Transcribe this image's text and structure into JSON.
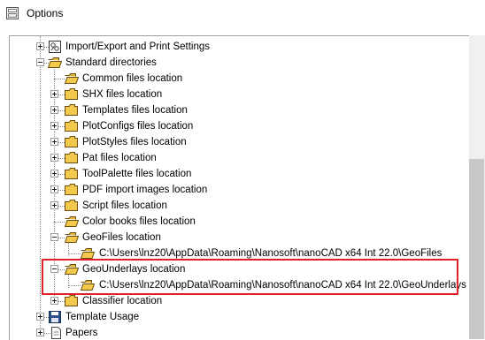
{
  "window": {
    "title": "Options"
  },
  "tree": {
    "items": [
      {
        "label": "Import/Export and Print Settings",
        "icon": "settings-icon",
        "expander": "plus"
      },
      {
        "label": "Standard directories",
        "icon": "folder-open-icon",
        "expander": "minus"
      },
      {
        "label": "Common files location",
        "icon": "folder-open-icon"
      },
      {
        "label": "SHX files location",
        "icon": "folder-icon",
        "expander": "plus"
      },
      {
        "label": "Templates files location",
        "icon": "folder-icon",
        "expander": "plus"
      },
      {
        "label": "PlotConfigs files location",
        "icon": "folder-icon",
        "expander": "plus"
      },
      {
        "label": "PlotStyles files location",
        "icon": "folder-icon",
        "expander": "plus"
      },
      {
        "label": "Pat files location",
        "icon": "folder-icon",
        "expander": "plus"
      },
      {
        "label": "ToolPalette files location",
        "icon": "folder-icon",
        "expander": "plus"
      },
      {
        "label": "PDF import images location",
        "icon": "folder-icon",
        "expander": "plus"
      },
      {
        "label": "Script files location",
        "icon": "folder-icon",
        "expander": "plus"
      },
      {
        "label": "Color books files location",
        "icon": "folder-open-icon"
      },
      {
        "label": "GeoFiles location",
        "icon": "folder-open-icon",
        "expander": "minus"
      },
      {
        "label": "C:\\Users\\lnz20\\AppData\\Roaming\\Nanosoft\\nanoCAD x64 Int 22.0\\GeoFiles",
        "icon": "folder-open-icon"
      },
      {
        "label": "GeoUnderlays location",
        "icon": "folder-open-icon",
        "expander": "minus"
      },
      {
        "label": "C:\\Users\\lnz20\\AppData\\Roaming\\Nanosoft\\nanoCAD x64 Int 22.0\\GeoUnderlays",
        "icon": "folder-open-icon"
      },
      {
        "label": "Classifier location",
        "icon": "folder-icon",
        "expander": "plus"
      },
      {
        "label": "Template Usage",
        "icon": "save-icon",
        "expander": "plus"
      },
      {
        "label": "Papers",
        "icon": "document-icon",
        "expander": "plus"
      }
    ]
  },
  "colors": {
    "highlight": "#e0202a",
    "folder": "#f2c94c"
  }
}
